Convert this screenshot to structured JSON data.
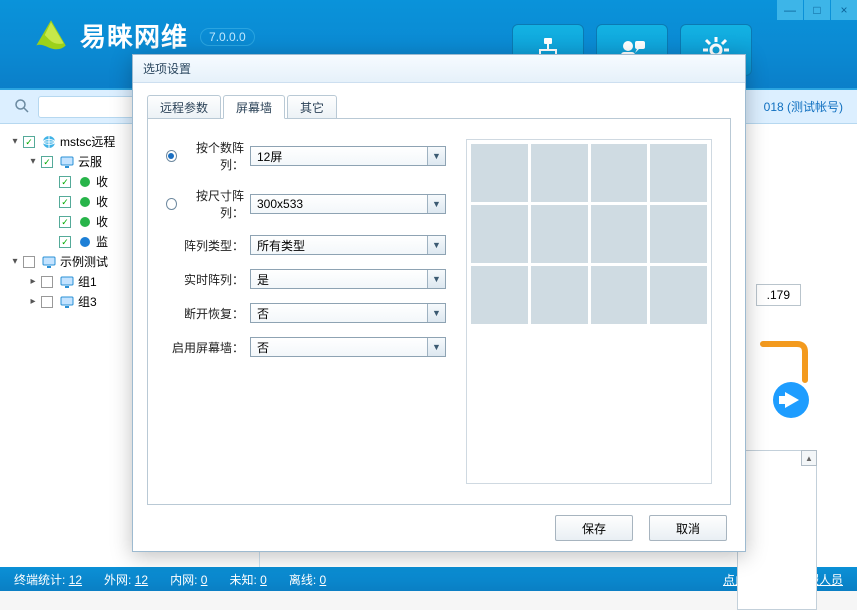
{
  "app": {
    "name": "易睐网维",
    "version": "7.0.0.0"
  },
  "window_controls": {
    "min": "—",
    "max": "□",
    "close": "×"
  },
  "account_label": "018 (测试帐号)",
  "right_fragment": {
    "ip": ".179"
  },
  "tree": [
    {
      "indent": 0,
      "twist": "▾",
      "checked": true,
      "icon": "globe",
      "label": "mstsc远程"
    },
    {
      "indent": 1,
      "twist": "▾",
      "checked": true,
      "icon": "mon",
      "label": "云服"
    },
    {
      "indent": 2,
      "twist": "",
      "checked": true,
      "icon": "grn",
      "label": "收"
    },
    {
      "indent": 2,
      "twist": "",
      "checked": true,
      "icon": "grn",
      "label": "收"
    },
    {
      "indent": 2,
      "twist": "",
      "checked": true,
      "icon": "grn",
      "label": "收"
    },
    {
      "indent": 2,
      "twist": "",
      "checked": true,
      "icon": "blu",
      "label": "监"
    },
    {
      "indent": 0,
      "twist": "▾",
      "checked": false,
      "icon": "mon",
      "label": "示例测试"
    },
    {
      "indent": 1,
      "twist": "▸",
      "checked": false,
      "icon": "mon",
      "label": "组1"
    },
    {
      "indent": 1,
      "twist": "▸",
      "checked": false,
      "icon": "mon",
      "label": "组3"
    }
  ],
  "status": {
    "terminals_label": "终端统计:",
    "terminals": "12",
    "outer_label": "外网:",
    "outer": "12",
    "inner_label": "内网:",
    "inner": "0",
    "unknown_label": "未知:",
    "unknown": "0",
    "offline_label": "离线:",
    "offline": "0",
    "contact": "点此联系在线客服人员"
  },
  "modal": {
    "title": "选项设置",
    "tabs": {
      "t0": "远程参数",
      "t1": "屏幕墙",
      "t2": "其它",
      "active": 1
    },
    "form": {
      "by_count_label": "按个数阵列：",
      "by_count_value": "12屏",
      "by_size_label": "按尺寸阵列：",
      "by_size_value": "300x533",
      "type_label": "阵列类型：",
      "type_value": "所有类型",
      "realtime_label": "实时阵列：",
      "realtime_value": "是",
      "restore_label": "断开恢复：",
      "restore_value": "否",
      "enable_label": "启用屏幕墙：",
      "enable_value": "否"
    },
    "buttons": {
      "save": "保存",
      "cancel": "取消"
    }
  }
}
